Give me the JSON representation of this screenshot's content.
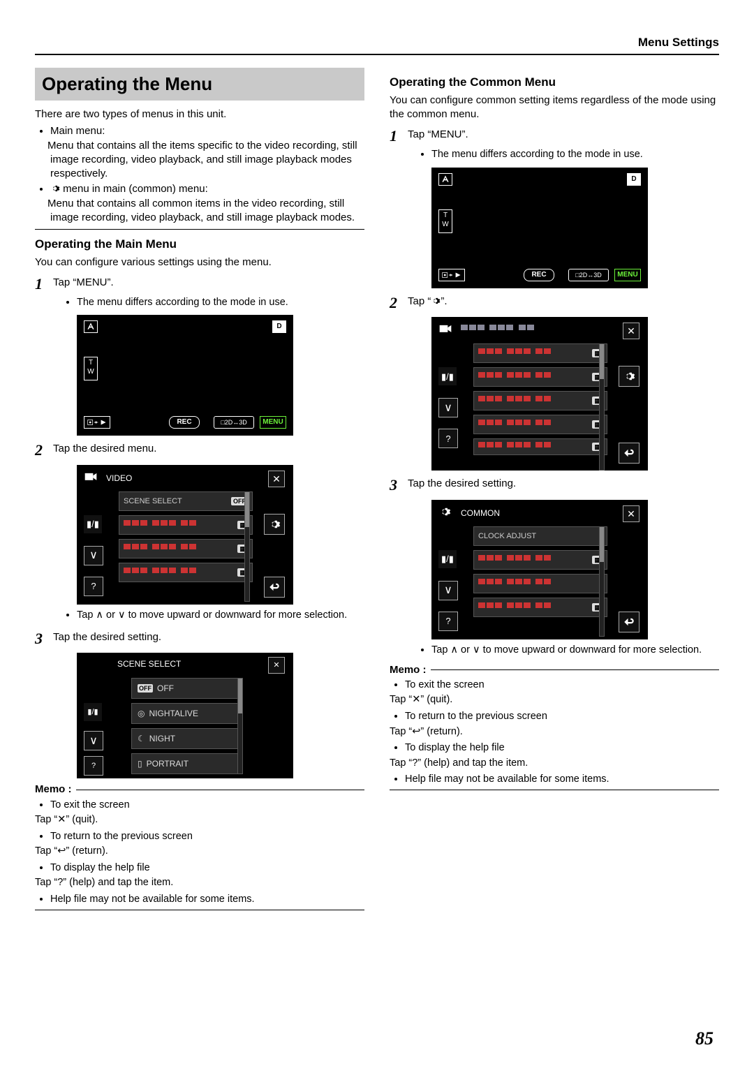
{
  "header": {
    "section": "Menu Settings"
  },
  "page_number": "85",
  "left": {
    "h1": "Operating the Menu",
    "intro": "There are two types of menus in this unit.",
    "bullet1_label": "Main menu:",
    "bullet1_text": "Menu that contains all the items specific to the video recording, still image recording, video playback, and still image playback modes respectively.",
    "bullet2_label": " menu in main (common) menu:",
    "bullet2_text": "Menu that contains all common items in the video recording, still image recording, video playback, and still image playback modes.",
    "h2": "Operating the Main Menu",
    "h2_intro": "You can configure various settings using the menu.",
    "step1": "Tap “MENU”.",
    "step1_bullet": "The menu differs according to the mode in use.",
    "step2": "Tap the desired menu.",
    "step2_bullet": "Tap ∧ or ∨ to move upward or downward for more selection.",
    "step3": "Tap the desired setting.",
    "memo_label": "Memo :",
    "memo_b1": "To exit the screen",
    "memo_p1": "Tap “✕” (quit).",
    "memo_b2": "To return to the previous screen",
    "memo_p2": "Tap “↩” (return).",
    "memo_b3": "To display the help file",
    "memo_p3": "Tap “?” (help) and tap the item.",
    "memo_b4": "Help file may not be available for some items.",
    "cam": {
      "d": "D",
      "tw_t": "T",
      "tw_w": "W",
      "rec": "REC",
      "mode23": "□2D↔3D",
      "menu": "MENU"
    },
    "menu_list": {
      "title": "VIDEO",
      "row1": "SCENE SELECT",
      "row1_val": "OFF"
    },
    "scene": {
      "title": "SCENE SELECT",
      "off_badge": "OFF",
      "o1": "OFF",
      "o2": "NIGHTALIVE",
      "o3": "NIGHT",
      "o4": "PORTRAIT"
    }
  },
  "right": {
    "h2": "Operating the Common Menu",
    "h2_intro": "You can configure common setting items regardless of the mode using the common menu.",
    "step1": "Tap “MENU”.",
    "step1_bullet": "The menu differs according to the mode in use.",
    "step2_a": "Tap “",
    "step2_b": "”.",
    "step3": "Tap the desired setting.",
    "step3_bullet": "Tap ∧ or ∨ to move upward or downward for more selection.",
    "common_list": {
      "title": "COMMON",
      "row1": "CLOCK ADJUST"
    },
    "memo_label": "Memo :",
    "memo_b1": "To exit the screen",
    "memo_p1": "Tap “✕” (quit).",
    "memo_b2": "To return to the previous screen",
    "memo_p2": "Tap “↩” (return).",
    "memo_b3": "To display the help file",
    "memo_p3": "Tap “?” (help) and tap the item.",
    "memo_b4": "Help file may not be available for some items."
  }
}
